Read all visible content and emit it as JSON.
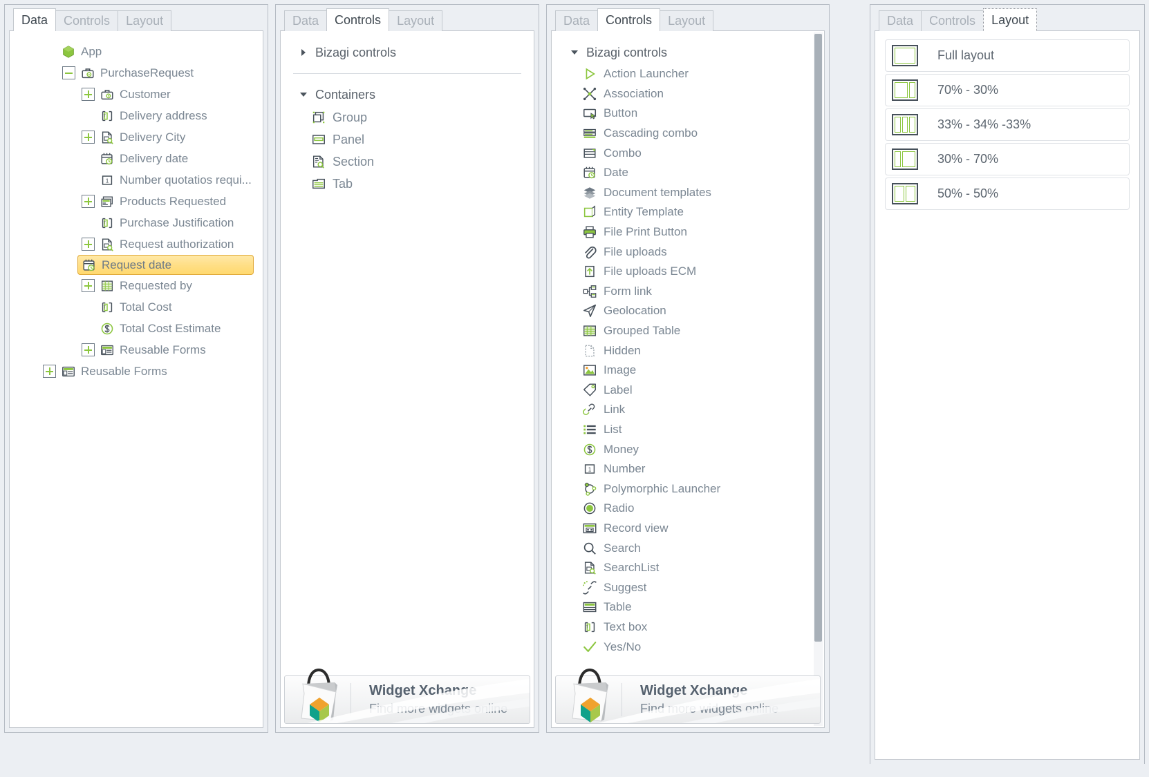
{
  "panel_data": {
    "tabs": [
      {
        "label": "Data",
        "active": true
      },
      {
        "label": "Controls",
        "active": false
      },
      {
        "label": "Layout",
        "active": false
      }
    ],
    "tree": [
      {
        "label": "App",
        "indent": 0,
        "expander": "none",
        "icon": "app-hex-icon"
      },
      {
        "label": "PurchaseRequest",
        "indent": 1,
        "expander": "minus",
        "icon": "entity-briefcase-icon"
      },
      {
        "label": "Customer",
        "indent": 2,
        "expander": "plus",
        "icon": "entity-briefcase-icon"
      },
      {
        "label": "Delivery address",
        "indent": 2,
        "expander": "none",
        "icon": "textbox-icon"
      },
      {
        "label": "Delivery City",
        "indent": 2,
        "expander": "plus",
        "icon": "searchlist-icon"
      },
      {
        "label": "Delivery date",
        "indent": 2,
        "expander": "none",
        "icon": "date-icon"
      },
      {
        "label": "Number quotatios requi...",
        "indent": 2,
        "expander": "none",
        "icon": "number-icon"
      },
      {
        "label": "Products Requested",
        "indent": 2,
        "expander": "plus",
        "icon": "collection-icon"
      },
      {
        "label": "Purchase Justification",
        "indent": 2,
        "expander": "none",
        "icon": "textbox-icon"
      },
      {
        "label": "Request authorization",
        "indent": 2,
        "expander": "plus",
        "icon": "searchlist-icon"
      },
      {
        "label": "Request date",
        "indent": 2,
        "expander": "none",
        "icon": "date-icon",
        "selected": true
      },
      {
        "label": "Requested by",
        "indent": 2,
        "expander": "plus",
        "icon": "grid-icon"
      },
      {
        "label": "Total Cost",
        "indent": 2,
        "expander": "none",
        "icon": "textbox-icon"
      },
      {
        "label": "Total Cost Estimate",
        "indent": 2,
        "expander": "none",
        "icon": "money-icon"
      },
      {
        "label": "Reusable Forms",
        "indent": 2,
        "expander": "plus",
        "icon": "reusable-forms-icon"
      },
      {
        "label": "Reusable Forms",
        "indent": 0,
        "expander": "plus",
        "icon": "reusable-forms-icon"
      }
    ]
  },
  "panel_containers": {
    "tabs": [
      {
        "label": "Data",
        "active": false
      },
      {
        "label": "Controls",
        "active": true
      },
      {
        "label": "Layout",
        "active": false
      }
    ],
    "group_bizagi": {
      "label": "Bizagi controls",
      "state": "collapsed"
    },
    "group_containers": {
      "label": "Containers",
      "state": "expanded"
    },
    "items": [
      {
        "label": "Group",
        "icon": "group-icon"
      },
      {
        "label": "Panel",
        "icon": "panel-icon"
      },
      {
        "label": "Section",
        "icon": "section-icon"
      },
      {
        "label": "Tab",
        "icon": "tab-icon"
      }
    ],
    "footer": {
      "title": "Widget Xchange",
      "subtitle": "Find more widgets online"
    }
  },
  "panel_controls": {
    "tabs": [
      {
        "label": "Data",
        "active": false
      },
      {
        "label": "Controls",
        "active": true
      },
      {
        "label": "Layout",
        "active": false
      }
    ],
    "group_bizagi": {
      "label": "Bizagi controls",
      "state": "expanded"
    },
    "items": [
      {
        "label": "Action Launcher",
        "icon": "play-triangle-icon"
      },
      {
        "label": "Association",
        "icon": "association-icon"
      },
      {
        "label": "Button",
        "icon": "button-icon"
      },
      {
        "label": "Cascading combo",
        "icon": "cascading-combo-icon"
      },
      {
        "label": "Combo",
        "icon": "combo-icon"
      },
      {
        "label": "Date",
        "icon": "date-icon"
      },
      {
        "label": "Document templates",
        "icon": "document-templates-icon"
      },
      {
        "label": "Entity Template",
        "icon": "entity-template-icon"
      },
      {
        "label": "File Print Button",
        "icon": "printer-icon"
      },
      {
        "label": "File uploads",
        "icon": "paperclip-icon"
      },
      {
        "label": "File uploads ECM",
        "icon": "upload-arrow-icon"
      },
      {
        "label": "Form link",
        "icon": "form-link-icon"
      },
      {
        "label": "Geolocation",
        "icon": "geolocation-icon"
      },
      {
        "label": "Grouped Table",
        "icon": "grouped-table-icon"
      },
      {
        "label": "Hidden",
        "icon": "hidden-icon"
      },
      {
        "label": "Image",
        "icon": "image-icon"
      },
      {
        "label": "Label",
        "icon": "label-tag-icon"
      },
      {
        "label": "Link",
        "icon": "link-chain-icon"
      },
      {
        "label": "List",
        "icon": "list-icon"
      },
      {
        "label": "Money",
        "icon": "money-icon"
      },
      {
        "label": "Number",
        "icon": "number-icon"
      },
      {
        "label": "Polymorphic Launcher",
        "icon": "polymorphic-launcher-icon"
      },
      {
        "label": "Radio",
        "icon": "radio-icon"
      },
      {
        "label": "Record view",
        "icon": "record-view-icon"
      },
      {
        "label": "Search",
        "icon": "search-icon"
      },
      {
        "label": "SearchList",
        "icon": "searchlist-icon"
      },
      {
        "label": "Suggest",
        "icon": "suggest-icon"
      },
      {
        "label": "Table",
        "icon": "table-icon"
      },
      {
        "label": "Text box",
        "icon": "textbox-icon"
      },
      {
        "label": "Yes/No",
        "icon": "check-icon"
      }
    ],
    "footer": {
      "title": "Widget Xchange",
      "subtitle": "Find more widgets online"
    }
  },
  "panel_layout": {
    "tabs": [
      {
        "label": "Data",
        "active": false
      },
      {
        "label": "Controls",
        "active": false
      },
      {
        "label": "Layout",
        "active": true
      }
    ],
    "items": [
      {
        "label": "Full layout",
        "columns": [
          100
        ]
      },
      {
        "label": "70% - 30%",
        "columns": [
          70,
          30
        ]
      },
      {
        "label": "33% - 34% -33%",
        "columns": [
          33,
          34,
          33
        ]
      },
      {
        "label": "30% - 70%",
        "columns": [
          30,
          70
        ]
      },
      {
        "label": "50% - 50%",
        "columns": [
          50,
          50
        ]
      }
    ]
  },
  "colors": {
    "accent_green": "#8cc63f",
    "icon_dark": "#46505a",
    "text_gray": "#7b8793",
    "selection_border": "#e0a93a"
  }
}
